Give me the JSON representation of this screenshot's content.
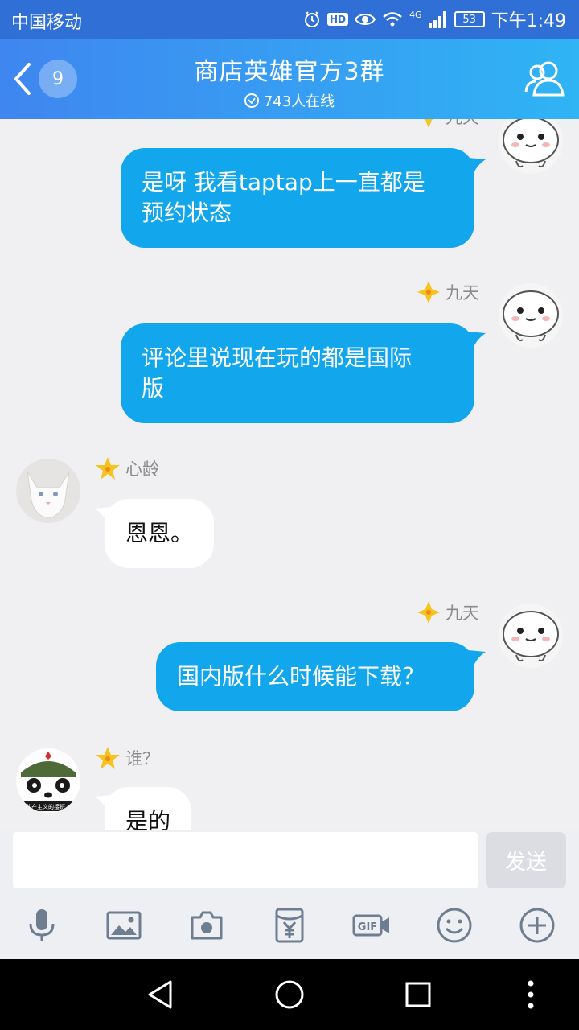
{
  "status_bar": {
    "carrier": "中国移动",
    "hd": "HD",
    "network": "4G",
    "battery": "53",
    "time": "下午1:49"
  },
  "header": {
    "unread_count": "9",
    "title": "商店英雄官方3群",
    "online_status": "743人在线"
  },
  "messages": [
    {
      "side": "me",
      "name": "九天",
      "lines": [
        "是呀 我看taptap上一直都是",
        "预约状态"
      ]
    },
    {
      "side": "me",
      "name": "九天",
      "lines": [
        "评论里说现在玩的都是国际",
        "版"
      ]
    },
    {
      "side": "other",
      "name": "心龄",
      "lines": [
        "恩恩。"
      ]
    },
    {
      "side": "me",
      "name": "九天",
      "lines": [
        "国内版什么时候能下载？"
      ]
    },
    {
      "side": "other",
      "name": "谁？",
      "lines": [
        "是的"
      ],
      "avatar_text": "共产主义的接班人"
    }
  ],
  "input": {
    "value": "",
    "send_label": "发送"
  },
  "toolbar": [
    "microphone-icon",
    "image-icon",
    "camera-icon",
    "red-packet-icon",
    "gif-icon",
    "emoji-icon",
    "plus-icon"
  ],
  "colors": {
    "header_start": "#3f86f0",
    "header_end": "#2fb4f4",
    "my_bubble": "#12a6ed",
    "other_bubble": "#ffffff",
    "send_disabled": "#dcdde2"
  }
}
